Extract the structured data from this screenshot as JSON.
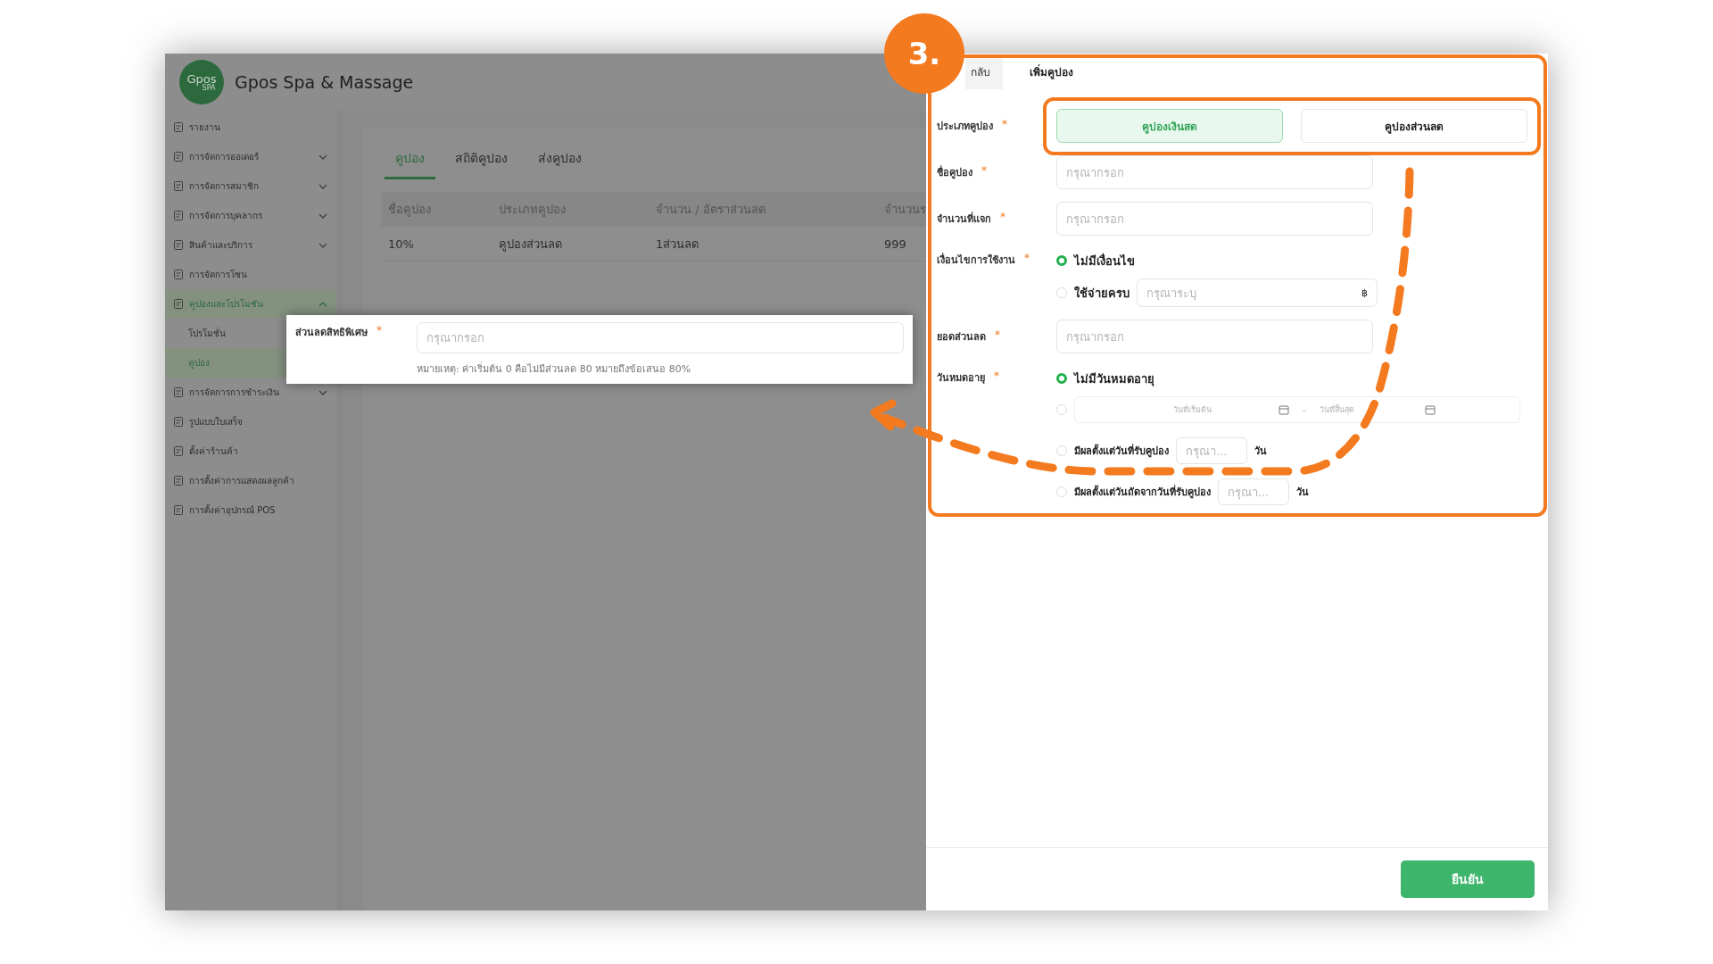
{
  "app": {
    "logo": {
      "main": "Gpos",
      "sub": "SPA"
    },
    "title": "Gpos Spa & Massage"
  },
  "sidebar": {
    "items": [
      {
        "label": "รายงาน",
        "kind": "link",
        "selected": false
      },
      {
        "label": "การจัดการออเดอร์",
        "kind": "group",
        "expanded": false,
        "selected": false
      },
      {
        "label": "การจัดการสมาชิก",
        "kind": "group",
        "expanded": false,
        "selected": false
      },
      {
        "label": "การจัดการบุคลากร",
        "kind": "group",
        "expanded": false,
        "selected": false
      },
      {
        "label": "สินค้าและบริการ",
        "kind": "group",
        "expanded": false,
        "selected": false
      },
      {
        "label": "การจัดการโซน",
        "kind": "link",
        "selected": false
      },
      {
        "label": "คูปองและโปรโมชัน",
        "kind": "group",
        "expanded": true,
        "selected": true,
        "children": [
          {
            "label": "โปรโมชั่น",
            "selected": false
          },
          {
            "label": "คูปอง",
            "selected": true
          }
        ]
      },
      {
        "label": "การจัดการการชำระเงิน",
        "kind": "group",
        "expanded": false,
        "selected": false
      },
      {
        "label": "รูปแบบใบเสร็จ",
        "kind": "link",
        "selected": false
      },
      {
        "label": "ตั้งค่าร้านค้า",
        "kind": "link",
        "selected": false
      },
      {
        "label": "การตั้งค่าการแสดงผลลูกค้า",
        "kind": "link",
        "selected": false
      },
      {
        "label": "การตั้งค่าอุปกรณ์ POS",
        "kind": "link",
        "selected": false
      }
    ]
  },
  "tabs": [
    {
      "label": "คูปอง",
      "selected": true
    },
    {
      "label": "สถิติคูปอง",
      "selected": false
    },
    {
      "label": "ส่งคูปอง",
      "selected": false
    }
  ],
  "table": {
    "columns": [
      "ชื่อคูปอง",
      "ประเภทคูปอง",
      "จำนวน / อัตราส่วนลด",
      "จำนวนร"
    ],
    "rows": [
      [
        "10%",
        "คูปองส่วนลด",
        "1ส่วนลด",
        "999"
      ]
    ]
  },
  "callout": {
    "label": "ส่วนลดสิทธิพิเศษ",
    "mark": "*",
    "placeholder": "กรุณากรอก",
    "note": "หมายเหตุ: ค่าเริ่มต้น 0 คือไม่มีส่วนลด 80 หมายถึงข้อเสนอ 80%"
  },
  "drawer": {
    "back": "กลับ",
    "title": "เพิ่มคูปอง",
    "coupon_type": {
      "label": "ประเภทคูปอง",
      "mark": "*",
      "options": [
        {
          "label": "คูปองเงินสด",
          "selected": true
        },
        {
          "label": "คูปองส่วนลด",
          "selected": false
        }
      ]
    },
    "name": {
      "label": "ชื่อคูปอง",
      "mark": "*",
      "placeholder": "กรุณากรอก"
    },
    "quantity": {
      "label": "จำนวนที่แจก",
      "mark": "*",
      "placeholder": "กรุณากรอก"
    },
    "condition": {
      "label": "เงื่อนไขการใช้งาน",
      "mark": "*",
      "options": [
        {
          "kind": "plain",
          "label": "ไม่มีเงื่อนไข",
          "selected": true
        },
        {
          "kind": "amount",
          "label": "ใช้จ่ายครบ",
          "placeholder": "กรุณาระบุ",
          "suffix": "฿",
          "selected": false
        }
      ]
    },
    "discount": {
      "label": "ยอดส่วนลด",
      "mark": "*",
      "placeholder": "กรุณากรอก"
    },
    "expiry": {
      "label": "วันหมดอายุ",
      "mark": "*",
      "options": [
        {
          "kind": "plain",
          "label": "ไม่มีวันหมดอายุ",
          "selected": true
        },
        {
          "kind": "range",
          "start_placeholder": "วันที่เริ่มต้น",
          "separator": "–",
          "end_placeholder": "วันที่สิ้นสุด",
          "selected": false
        },
        {
          "kind": "days",
          "label": "มีผลตั้งแต่วันที่รับคูปอง",
          "placeholder": "กรุณา...",
          "unit": "วัน",
          "selected": false
        },
        {
          "kind": "days",
          "label": "มีผลตั้งแต่วันถัดจากวันที่รับคูปอง",
          "placeholder": "กรุณา...",
          "unit": "วัน",
          "selected": false
        }
      ]
    },
    "confirm": "ยืนยัน"
  },
  "annotation": {
    "step": "3."
  }
}
